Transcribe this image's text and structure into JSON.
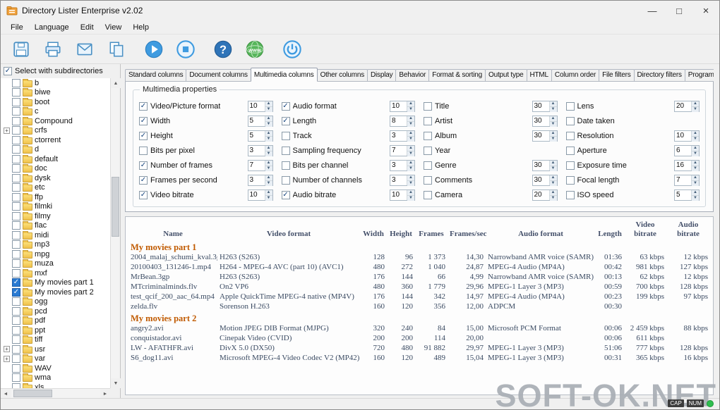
{
  "window": {
    "title": "Directory Lister Enterprise v2.02",
    "controls": {
      "minimize": "—",
      "maximize": "□",
      "close": "×"
    }
  },
  "menu": {
    "items": [
      "File",
      "Language",
      "Edit",
      "View",
      "Help"
    ]
  },
  "toolbar": {
    "help_glyph": "?",
    "www_label": "www"
  },
  "sidebar": {
    "header": "Select with subdirectories",
    "header_checked": true,
    "items": [
      {
        "label": "b",
        "checked": false
      },
      {
        "label": "biwe",
        "checked": false
      },
      {
        "label": "boot",
        "checked": false
      },
      {
        "label": "c",
        "checked": false
      },
      {
        "label": "Compound",
        "checked": false
      },
      {
        "label": "crfs",
        "checked": false,
        "expander": true
      },
      {
        "label": "ctorrent",
        "checked": false
      },
      {
        "label": "d",
        "checked": false
      },
      {
        "label": "default",
        "checked": false
      },
      {
        "label": "doc",
        "checked": false
      },
      {
        "label": "dysk",
        "checked": false
      },
      {
        "label": "etc",
        "checked": false
      },
      {
        "label": "ffp",
        "checked": false
      },
      {
        "label": "filmki",
        "checked": false
      },
      {
        "label": "filmy",
        "checked": false
      },
      {
        "label": "flac",
        "checked": false
      },
      {
        "label": "midi",
        "checked": false
      },
      {
        "label": "mp3",
        "checked": false
      },
      {
        "label": "mpg",
        "checked": false
      },
      {
        "label": "muza",
        "checked": false
      },
      {
        "label": "mxf",
        "checked": false
      },
      {
        "label": "My movies part 1",
        "checked": true
      },
      {
        "label": "My movies part 2",
        "checked": true
      },
      {
        "label": "ogg",
        "checked": false
      },
      {
        "label": "pcd",
        "checked": false
      },
      {
        "label": "pdf",
        "checked": false
      },
      {
        "label": "ppt",
        "checked": false
      },
      {
        "label": "tiff",
        "checked": false
      },
      {
        "label": "usr",
        "checked": false,
        "expander": true
      },
      {
        "label": "var",
        "checked": false,
        "expander": true
      },
      {
        "label": "WAV",
        "checked": false
      },
      {
        "label": "wma",
        "checked": false
      },
      {
        "label": "xls",
        "checked": false
      }
    ]
  },
  "tabs": {
    "items": [
      "Standard columns",
      "Document columns",
      "Multimedia columns",
      "Other columns",
      "Display",
      "Behavior",
      "Format & sorting",
      "Output type",
      "HTML",
      "Column order",
      "File filters",
      "Directory filters",
      "Program options"
    ],
    "active": "Multimedia columns"
  },
  "multimedia": {
    "group_title": "Multimedia properties",
    "columns": [
      [
        {
          "label": "Video/Picture format",
          "checked": true,
          "value": "10"
        },
        {
          "label": "Width",
          "checked": true,
          "value": "5"
        },
        {
          "label": "Height",
          "checked": true,
          "value": "5"
        },
        {
          "label": "Bits per pixel",
          "checked": false,
          "value": "3"
        },
        {
          "label": "Number of frames",
          "checked": true,
          "value": "7"
        },
        {
          "label": "Frames per second",
          "checked": true,
          "value": "3"
        },
        {
          "label": "Video bitrate",
          "checked": true,
          "value": "10"
        }
      ],
      [
        {
          "label": "Audio format",
          "checked": true,
          "value": "10"
        },
        {
          "label": "Length",
          "checked": true,
          "value": "8"
        },
        {
          "label": "Track",
          "checked": false,
          "value": "3"
        },
        {
          "label": "Sampling frequency",
          "checked": false,
          "value": "7"
        },
        {
          "label": "Bits per channel",
          "checked": false,
          "value": "3"
        },
        {
          "label": "Number of channels",
          "checked": false,
          "value": "3"
        },
        {
          "label": "Audio bitrate",
          "checked": true,
          "value": "10"
        }
      ],
      [
        {
          "label": "Title",
          "checked": false,
          "value": "30"
        },
        {
          "label": "Artist",
          "checked": false,
          "value": "30"
        },
        {
          "label": "Album",
          "checked": false,
          "value": "30"
        },
        {
          "label": "Year",
          "checked": false,
          "value": null
        },
        {
          "label": "Genre",
          "checked": false,
          "value": "30"
        },
        {
          "label": "Comments",
          "checked": false,
          "value": "30"
        },
        {
          "label": "Camera",
          "checked": false,
          "value": "20"
        }
      ],
      [
        {
          "label": "Lens",
          "checked": false,
          "value": "20"
        },
        {
          "label": "Date taken",
          "checked": false,
          "value": null
        },
        {
          "label": "Resolution",
          "checked": false,
          "value": "10"
        },
        {
          "label": "Aperture",
          "checked": false,
          "value": "6"
        },
        {
          "label": "Exposure time",
          "checked": false,
          "value": "16"
        },
        {
          "label": "Focal length",
          "checked": false,
          "value": "7"
        },
        {
          "label": "ISO speed",
          "checked": false,
          "value": "5"
        }
      ]
    ]
  },
  "preview": {
    "headers": [
      "Name",
      "Video format",
      "Width",
      "Height",
      "Frames",
      "Frames/sec",
      "Audio format",
      "Length",
      "Video\nbitrate",
      "Audio\nbitrate"
    ],
    "groups": [
      {
        "name": "My movies part 1",
        "rows": [
          [
            "2004_malaj_schumi_kval.3gp",
            "H263 (S263)",
            "128",
            "96",
            "1 373",
            "14,30",
            "Narrowband AMR voice (SAMR)",
            "01:36",
            "63 kbps",
            "12 kbps"
          ],
          [
            "20100403_131246-1.mp4",
            "H264 - MPEG-4 AVC (part 10) (AVC1)",
            "480",
            "272",
            "1 040",
            "24,87",
            "MPEG-4 Audio (MP4A)",
            "00:42",
            "981 kbps",
            "127 kbps"
          ],
          [
            "MrBean.3gp",
            "H263 (S263)",
            "176",
            "144",
            "66",
            "4,99",
            "Narrowband AMR voice (SAMR)",
            "00:13",
            "62 kbps",
            "12 kbps"
          ],
          [
            "MTcriminalminds.flv",
            "On2 VP6",
            "480",
            "360",
            "1 779",
            "29,96",
            "MPEG-1 Layer 3 (MP3)",
            "00:59",
            "700 kbps",
            "128 kbps"
          ],
          [
            "test_qcif_200_aac_64.mp4",
            "Apple QuickTime MPEG-4 native (MP4V)",
            "176",
            "144",
            "342",
            "14,97",
            "MPEG-4 Audio (MP4A)",
            "00:23",
            "199 kbps",
            "97 kbps"
          ],
          [
            "zelda.flv",
            "Sorenson H.263",
            "160",
            "120",
            "356",
            "12,00",
            "ADPCM",
            "00:30",
            "",
            ""
          ]
        ]
      },
      {
        "name": "My movies part 2",
        "rows": [
          [
            "angry2.avi",
            "Motion JPEG DIB Format (MJPG)",
            "320",
            "240",
            "84",
            "15,00",
            "Microsoft PCM Format",
            "00:06",
            "2 459 kbps",
            "88 kbps"
          ],
          [
            "conquistador.avi",
            "Cinepak Video (CVID)",
            "200",
            "200",
            "114",
            "20,00",
            "",
            "00:06",
            "611 kbps",
            ""
          ],
          [
            "LW - AFATHFR.avi",
            "DivX 5.0 (DX50)",
            "720",
            "480",
            "91 882",
            "29,97",
            "MPEG-1 Layer 3 (MP3)",
            "51:06",
            "777 kbps",
            "128 kbps"
          ],
          [
            "S6_dog11.avi",
            "Microsoft MPEG-4 Video Codec V2 (MP42)",
            "160",
            "120",
            "489",
            "15,04",
            "MPEG-1 Layer 3 (MP3)",
            "00:31",
            "365 kbps",
            "16 kbps"
          ]
        ]
      }
    ]
  },
  "statusbar": {
    "cap": "CAP",
    "num": "NUM"
  },
  "watermark": {
    "text": "SOFT-OK.NET"
  }
}
